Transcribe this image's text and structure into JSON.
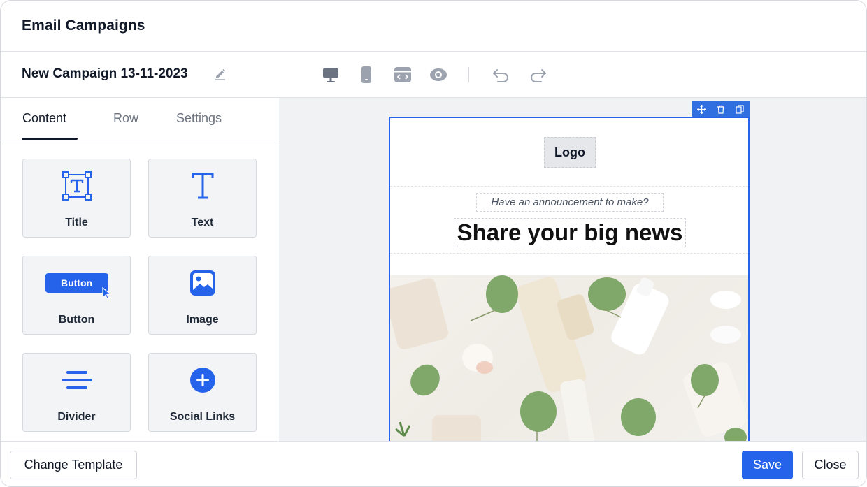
{
  "header": {
    "title": "Email Campaigns"
  },
  "toolbar": {
    "campaign_name": "New Campaign 13-11-2023",
    "icons": [
      "edit-icon",
      "desktop-icon",
      "mobile-icon",
      "code-icon",
      "preview-icon",
      "undo-icon",
      "redo-icon"
    ]
  },
  "sidebar": {
    "tabs": [
      {
        "label": "Content",
        "active": true
      },
      {
        "label": "Row",
        "active": false
      },
      {
        "label": "Settings",
        "active": false
      }
    ],
    "blocks": [
      {
        "label": "Title",
        "icon": "title-icon"
      },
      {
        "label": "Text",
        "icon": "text-icon"
      },
      {
        "label": "Button",
        "icon": "button-icon",
        "preview_label": "Button"
      },
      {
        "label": "Image",
        "icon": "image-icon"
      },
      {
        "label": "Divider",
        "icon": "divider-icon"
      },
      {
        "label": "Social Links",
        "icon": "plus-circle-icon"
      }
    ]
  },
  "canvas": {
    "block_tools": [
      "move-icon",
      "delete-icon",
      "duplicate-icon"
    ],
    "logo_text": "Logo",
    "announcement": "Have an announcement to make?",
    "headline": "Share your big news"
  },
  "footer": {
    "change_template": "Change Template",
    "save": "Save",
    "close": "Close"
  },
  "colors": {
    "accent": "#2563eb",
    "icon_gray": "#9ca3af",
    "text": "#111827",
    "leaf_green": "#7fa86a"
  }
}
